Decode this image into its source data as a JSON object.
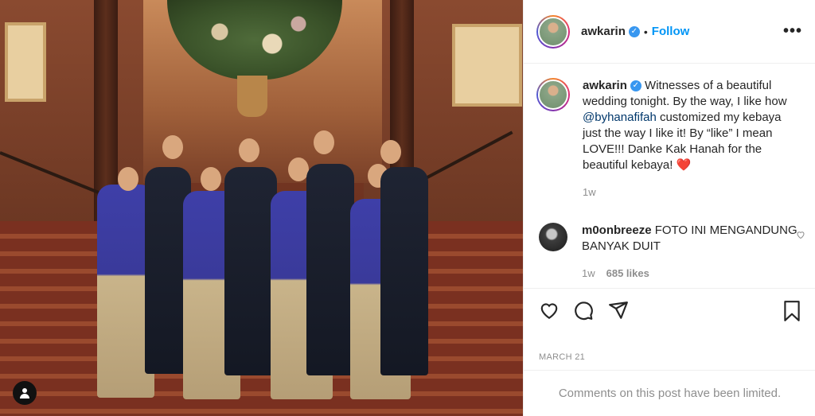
{
  "post": {
    "username": "awkarin",
    "follow_label": "Follow",
    "more_label": "•••",
    "separator": "•"
  },
  "caption": {
    "username": "awkarin",
    "text_1": "Witnesses of a beautiful wedding tonight. By the way, I like how ",
    "mention": "@byhanafifah",
    "text_2": " customized my kebaya just the way I like it! By “like” I mean LOVE!!! Danke Kak Hanah for the beautiful kebaya! ",
    "emoji": "❤️",
    "time": "1w"
  },
  "comment": {
    "username": "m0onbreeze",
    "text": " FOTO INI MENGANDUNG BANYAK DUIT",
    "time": "1w",
    "likes": "685 likes"
  },
  "footer": {
    "date": "MARCH 21",
    "limited_text": "Comments on this post have been limited."
  },
  "icons": [
    "heart-icon",
    "comment-icon",
    "share-icon",
    "bookmark-icon",
    "verified-icon",
    "user-tag-icon"
  ]
}
